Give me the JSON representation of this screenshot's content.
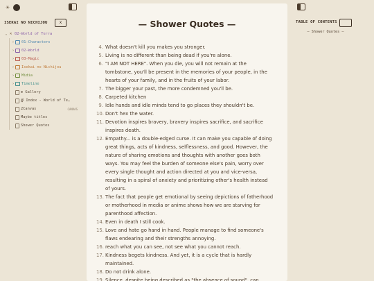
{
  "theme": {
    "background": "#ece5d6",
    "page": "#f8f5ee",
    "text": "#4a3a2a"
  },
  "sidebar": {
    "vault_name": "ISEKAI NO NICHIJOU",
    "close_icon": "x",
    "items": [
      {
        "label": "02-World of Terra",
        "level": 1,
        "color": "#8a5fa8",
        "icon": "root-icon",
        "chev": "⌄"
      },
      {
        "label": "01-Characters",
        "level": 2,
        "color": "#4f87b0",
        "icon": "folder-icon",
        "chev": "›"
      },
      {
        "label": "02-World",
        "level": 2,
        "color": "#8a5fa8",
        "icon": "folder-icon",
        "chev": "›"
      },
      {
        "label": "03-Magic",
        "level": 2,
        "color": "#b8564a",
        "icon": "folder-icon",
        "chev": "›"
      },
      {
        "label": "Isekai no Nichijou",
        "level": 2,
        "color": "#c07b3a",
        "icon": "folder-icon",
        "chev": "›"
      },
      {
        "label": "Midia",
        "level": 2,
        "color": "#6f8b3a",
        "icon": "folder-icon",
        "chev": "›"
      },
      {
        "label": "Timeline",
        "level": 2,
        "color": "#3f8d8a",
        "icon": "folder-icon",
        "chev": "›"
      },
      {
        "label": "⊕ Gallery",
        "level": 2,
        "color": "#5a4a3a",
        "icon": "file-icon",
        "chev": ""
      },
      {
        "label": "∯ Index - World of Te…",
        "level": 2,
        "color": "#5a4a3a",
        "icon": "file-icon",
        "chev": ""
      },
      {
        "label": "2Canvas",
        "level": 2,
        "color": "#5a4a3a",
        "icon": "file-icon",
        "chev": "",
        "badge": "CANVAS"
      },
      {
        "label": "Maybe titles",
        "level": 2,
        "color": "#5a4a3a",
        "icon": "file-icon",
        "chev": ""
      },
      {
        "label": "Shower Quotes",
        "level": 2,
        "color": "#5a4a3a",
        "icon": "file-icon",
        "chev": ""
      }
    ]
  },
  "page": {
    "title": "— Shower Quotes —",
    "quotes": [
      {
        "n": "4.",
        "text": "What doesn't kill you makes you stronger."
      },
      {
        "n": "5.",
        "text": "Living is no different than being dead if you're alone."
      },
      {
        "n": "6.",
        "text": "\"I AM NOT HERE\". When you die, you will not remain at the tombstone, you'll be present in the memories of your people, in the hearts of your family, and in the fruits of your labor."
      },
      {
        "n": "7.",
        "text": "The bigger your past, the more condemned you'll be."
      },
      {
        "n": "8.",
        "text": "Carpeted kitchen"
      },
      {
        "n": "9.",
        "text": "Idle hands and idle minds tend to go places they shouldn't be."
      },
      {
        "n": "10.",
        "text": "Don't hex the water."
      },
      {
        "n": "11.",
        "text": "Devotion inspires bravery, bravery inspires sacrifice, and sacrifice inspires death."
      },
      {
        "n": "12.",
        "text": "Empathy... is a double-edged curse. It can make you capable of doing great things, acts of kindness, selflessness, and good. However, the nature of sharing emotions and thoughts with another goes both ways. You may feel the burden of someone else's pain, worry over every single thought and action directed at you and vice-versa, resulting in a spiral of anxiety and prioritizing other's health instead of yours."
      },
      {
        "n": "13.",
        "text": "The fact that people get emotional by seeing depictions of fatherhood or motherhood in media or anime shows how we are starving for parenthood affection."
      },
      {
        "n": "14.",
        "text": "Even in death I still cook."
      },
      {
        "n": "15.",
        "text": "Love and hate go hand in hand. People manage to find someone's flaws endearing and their strengths annoying."
      },
      {
        "n": "16.",
        "text": "reach what you can see, not see what you cannot reach."
      },
      {
        "n": "17.",
        "text": "Kindness begets kindness. And yet, it is a cycle that is hardly maintained."
      },
      {
        "n": "18.",
        "text": "Do not drink alone."
      },
      {
        "n": "19.",
        "text": "Silence, despite being described as \"the absence of sound\", can"
      }
    ]
  },
  "toc": {
    "heading": "TABLE OF CONTENTS",
    "items": [
      "— Shower Quotes —"
    ]
  }
}
